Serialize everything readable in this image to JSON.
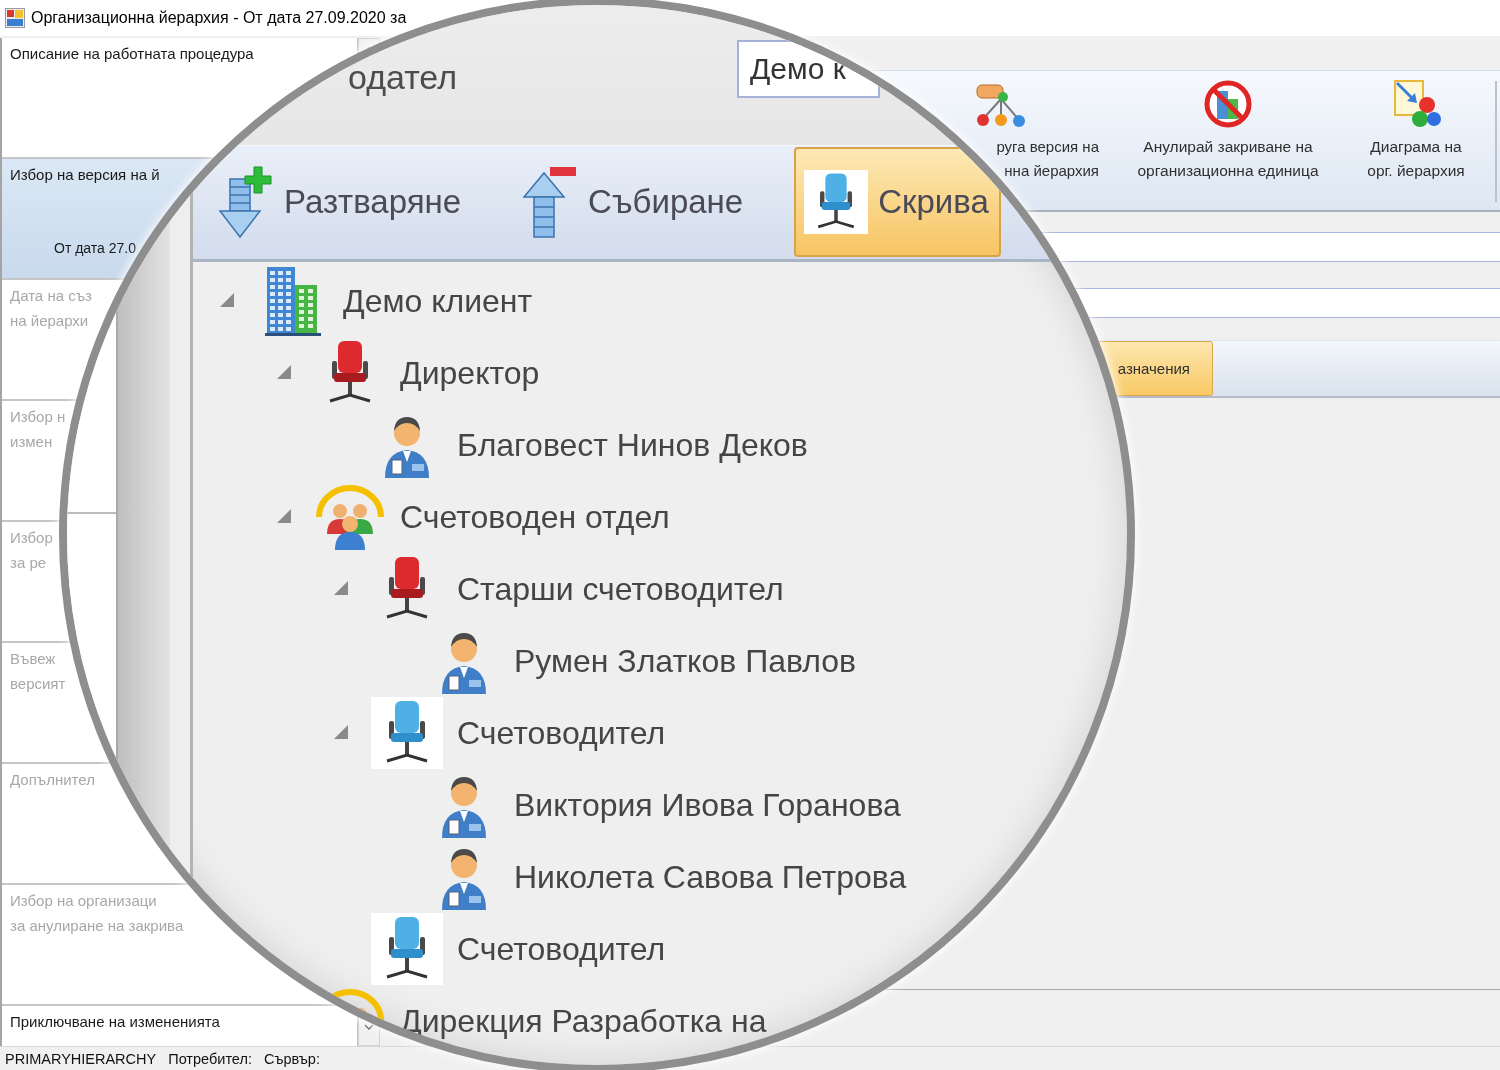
{
  "window": {
    "title": "Организационна йерархия - От дата 27.09.2020 за"
  },
  "steps_panel": {
    "steps": [
      {
        "lines": [
          "Описание на работната процедура"
        ],
        "selected": false,
        "disabled": false
      },
      {
        "lines": [
          "Избор на версия на й"
        ],
        "detail": "От дата 27.0",
        "selected": true,
        "disabled": false
      },
      {
        "lines": [
          "Дата на съз",
          "на йерархи"
        ],
        "selected": false,
        "disabled": true
      },
      {
        "lines": [
          "Избор н",
          "измен"
        ],
        "selected": false,
        "disabled": true
      },
      {
        "lines": [
          "Избор",
          "за ре"
        ],
        "selected": false,
        "disabled": true
      },
      {
        "lines": [
          "Въвеж",
          "версият"
        ],
        "selected": false,
        "disabled": true
      },
      {
        "lines": [
          "Допълнител"
        ],
        "selected": false,
        "disabled": true
      },
      {
        "lines": [
          "Избор на организаци",
          "за анулиране на закрива"
        ],
        "selected": false,
        "disabled": true
      },
      {
        "lines": [
          "Приключване на измененията"
        ],
        "selected": false,
        "disabled": false
      }
    ]
  },
  "ribbon": {
    "buttons": [
      {
        "kind": "versions",
        "lines": [
          "руга версия на",
          "нна йерархия"
        ]
      },
      {
        "kind": "cancel",
        "lines": [
          "Анулирай закриване на",
          "организационна единица"
        ]
      },
      {
        "kind": "diagram",
        "lines": [
          "Диаграма на",
          "орг. йерархия"
        ]
      }
    ]
  },
  "toolbar": {
    "buttons": [
      {
        "label": "азначения",
        "on": true
      }
    ]
  },
  "magnifier": {
    "field_label": "одател",
    "field_value": "Демо к",
    "toolbar": [
      {
        "kind": "expand",
        "label": "Разтваряне",
        "on": false
      },
      {
        "kind": "collapse",
        "label": "Събиране",
        "on": false
      },
      {
        "kind": "hide",
        "label": "Скрива",
        "on": true
      }
    ],
    "tree": [
      {
        "label": "Демо клиент",
        "kind": "company",
        "expanded": true,
        "children": [
          {
            "label": "Директор",
            "kind": "position",
            "hidden": false,
            "expanded": true,
            "children": [
              {
                "label": "Благовест Нинов Деков",
                "kind": "employee"
              }
            ]
          },
          {
            "label": "Счетоводен отдел",
            "kind": "department",
            "expanded": true,
            "children": [
              {
                "label": "Старши счетоводител",
                "kind": "position",
                "hidden": false,
                "expanded": true,
                "children": [
                  {
                    "label": "Румен Златков Павлов",
                    "kind": "employee"
                  }
                ]
              },
              {
                "label": "Счетоводител",
                "kind": "position",
                "hidden": true,
                "expanded": true,
                "children": [
                  {
                    "label": "Виктория Ивова Горанова",
                    "kind": "employee"
                  },
                  {
                    "label": "Николета Савова Петрова",
                    "kind": "employee"
                  }
                ]
              },
              {
                "label": "Счетоводител",
                "kind": "position",
                "hidden": true
              }
            ]
          },
          {
            "label": "Дирекция Разработка на",
            "kind": "department"
          }
        ]
      }
    ]
  },
  "status_bar": {
    "items": [
      "PRIMARYHIERARCHY",
      "Потребител:",
      "Сървър:"
    ]
  }
}
